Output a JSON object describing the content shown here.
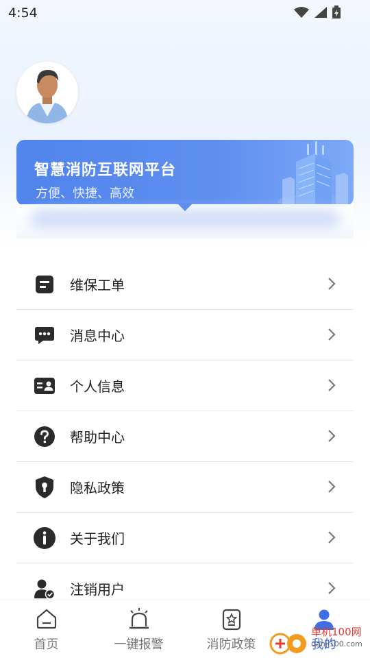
{
  "status_bar": {
    "time": "4:54"
  },
  "banner": {
    "title": "智慧消防互联网平台",
    "subtitle": "方便、快捷、高效"
  },
  "menu": [
    {
      "label": "维保工单",
      "icon": "work-order-icon"
    },
    {
      "label": "消息中心",
      "icon": "message-icon"
    },
    {
      "label": "个人信息",
      "icon": "id-card-icon"
    },
    {
      "label": "帮助中心",
      "icon": "help-icon"
    },
    {
      "label": "隐私政策",
      "icon": "shield-lock-icon"
    },
    {
      "label": "关于我们",
      "icon": "info-icon"
    },
    {
      "label": "注销用户",
      "icon": "user-check-icon"
    }
  ],
  "tabs": [
    {
      "label": "首页",
      "icon": "home-icon"
    },
    {
      "label": "一键报警",
      "icon": "alarm-icon"
    },
    {
      "label": "消防政策",
      "icon": "policy-icon"
    },
    {
      "label": "我的",
      "icon": "user-icon",
      "active": true
    }
  ],
  "watermark": {
    "line1": "单机100网",
    "line2": "danji100.com"
  },
  "colors": {
    "accent": "#3e6fe5",
    "banner": "#5e8ff0",
    "text": "#222222"
  }
}
